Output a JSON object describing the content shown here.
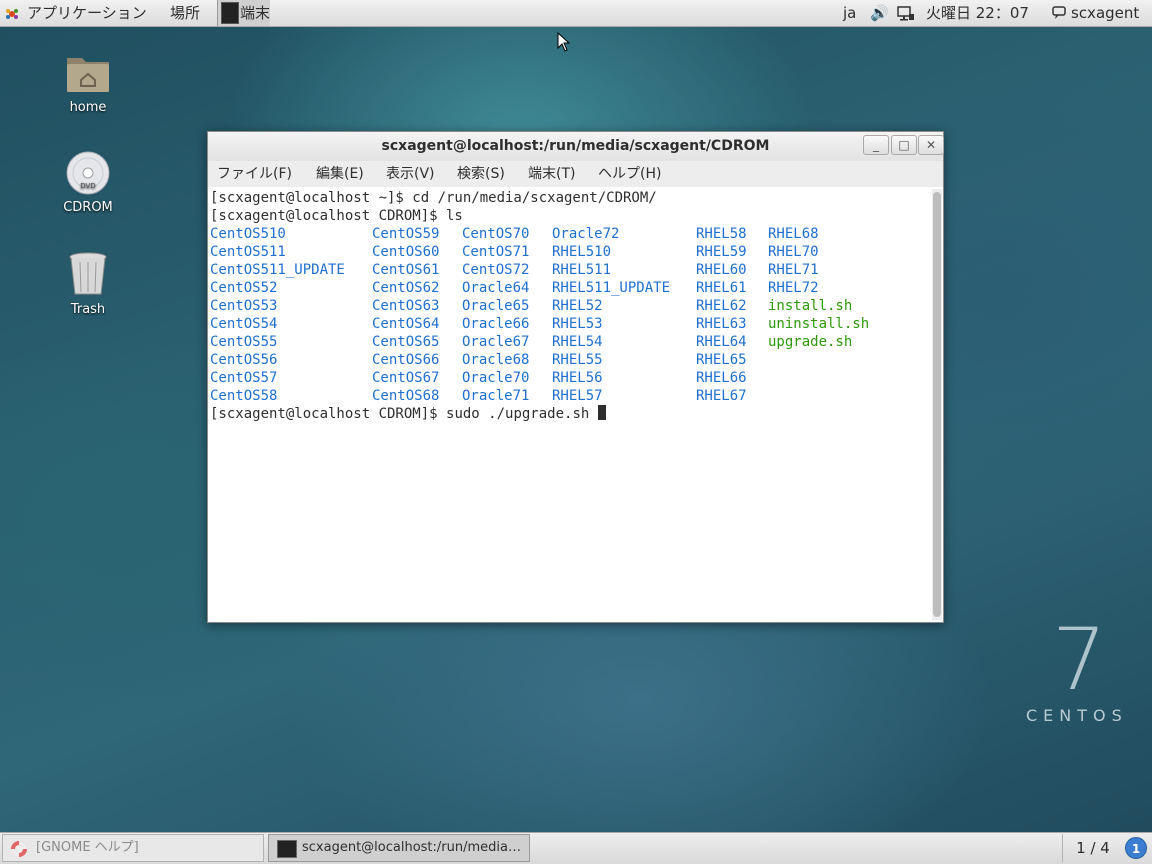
{
  "top_panel": {
    "applications": "アプリケーション",
    "places": "場所",
    "terminal_task": "端末",
    "lang": "ja",
    "clock": "火曜日 22：07",
    "user": "scxagent"
  },
  "desktop": {
    "icons": [
      {
        "label": "home"
      },
      {
        "label": "CDROM"
      },
      {
        "label": "Trash"
      }
    ]
  },
  "window": {
    "title": "scxagent@localhost:/run/media/scxagent/CDROM",
    "buttons": {
      "minimize": "_",
      "maximize": "□",
      "close": "✕"
    },
    "menu": [
      "ファイル(F)",
      "編集(E)",
      "表示(V)",
      "検索(S)",
      "端末(T)",
      "ヘルプ(H)"
    ]
  },
  "terminal": {
    "line1": "[scxagent@localhost ~]$ cd /run/media/scxagent/CDROM/",
    "line2": "[scxagent@localhost CDROM]$ ls",
    "ls_columns": [
      [
        "CentOS510",
        "CentOS511",
        "CentOS511_UPDATE",
        "CentOS52",
        "CentOS53",
        "CentOS54",
        "CentOS55",
        "CentOS56",
        "CentOS57",
        "CentOS58"
      ],
      [
        "CentOS59",
        "CentOS60",
        "CentOS61",
        "CentOS62",
        "CentOS63",
        "CentOS64",
        "CentOS65",
        "CentOS66",
        "CentOS67",
        "CentOS68"
      ],
      [
        "CentOS70",
        "CentOS71",
        "CentOS72",
        "Oracle64",
        "Oracle65",
        "Oracle66",
        "Oracle67",
        "Oracle68",
        "Oracle70",
        "Oracle71"
      ],
      [
        "Oracle72",
        "RHEL510",
        "RHEL511",
        "RHEL511_UPDATE",
        "RHEL52",
        "RHEL53",
        "RHEL54",
        "RHEL55",
        "RHEL56",
        "RHEL57"
      ],
      [
        "RHEL58",
        "RHEL59",
        "RHEL60",
        "RHEL61",
        "RHEL62",
        "RHEL63",
        "RHEL64",
        "RHEL65",
        "RHEL66",
        "RHEL67"
      ],
      [
        "RHEL68",
        "RHEL70",
        "RHEL71",
        "RHEL72"
      ]
    ],
    "scripts": [
      "install.sh",
      "uninstall.sh",
      "upgrade.sh"
    ],
    "prompt": "[scxagent@localhost CDROM]$ ",
    "command": "sudo ./upgrade.sh "
  },
  "watermark": {
    "number": "7",
    "word": "CENTOS"
  },
  "bottom_panel": {
    "tasks": [
      "[GNOME ヘルプ]",
      "scxagent@localhost:/run/media…"
    ],
    "workspace": "1 / 4",
    "notifications": "1"
  },
  "colors": {
    "dir": "#1f6fd0",
    "exec": "#2c9a0a"
  }
}
